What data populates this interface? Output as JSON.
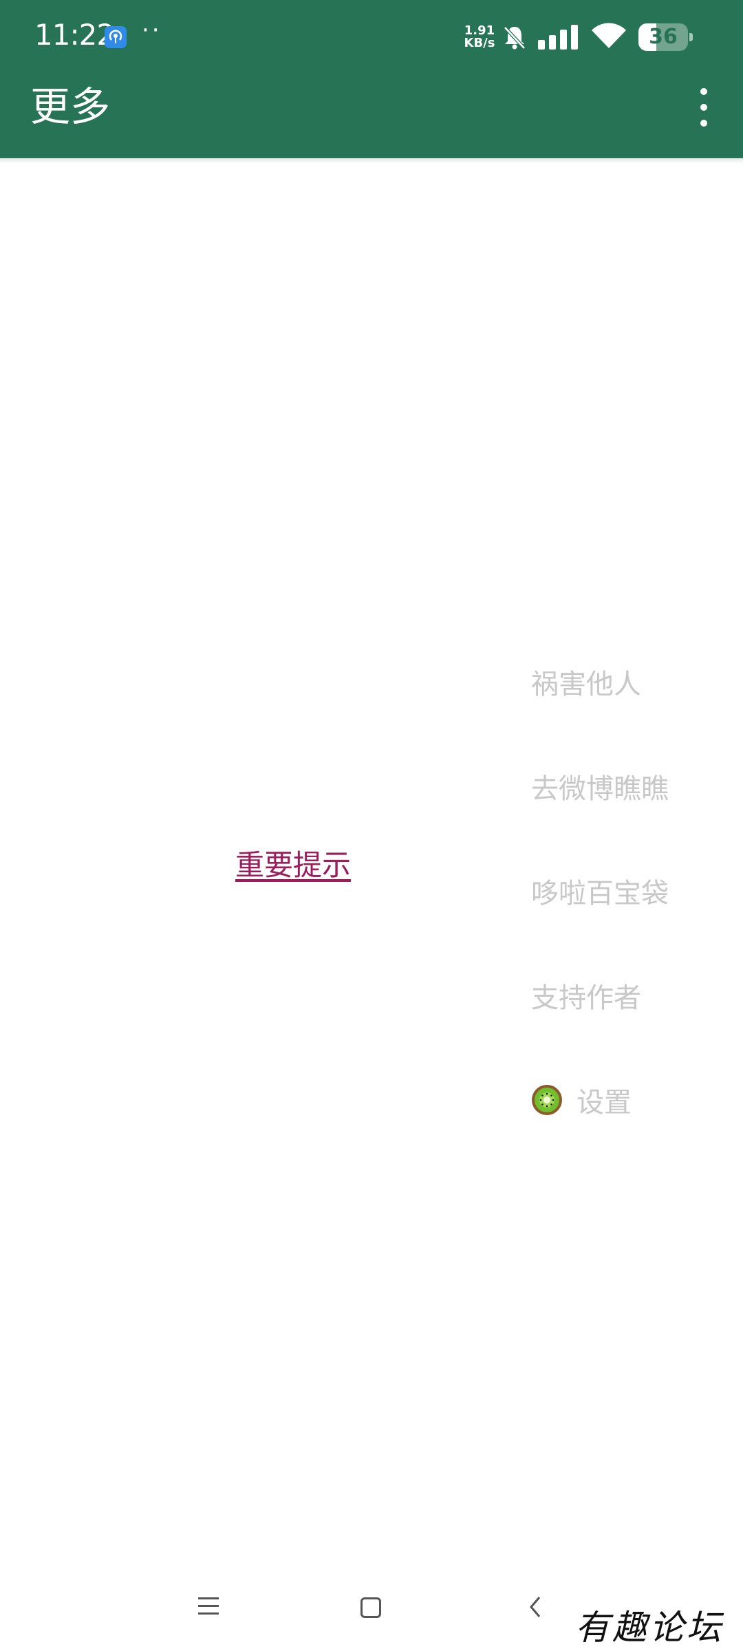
{
  "status_bar": {
    "time": "11:22",
    "dots": "··",
    "net_speed_value": "1.91",
    "net_speed_unit": "KB/s",
    "battery_level": "36",
    "battery_fraction": 0.36,
    "icons": [
      "hotspot-icon",
      "mute-bell-icon",
      "signal-icon",
      "wifi-icon",
      "battery-icon"
    ]
  },
  "app_bar": {
    "title": "更多",
    "overflow_icon": "more-vert-icon"
  },
  "content": {
    "notice_link": "重要提示"
  },
  "menu": {
    "items": [
      {
        "label": "祸害他人"
      },
      {
        "label": "去微博瞧瞧"
      },
      {
        "label": "哆啦百宝袋"
      },
      {
        "label": "支持作者"
      },
      {
        "label": "设置",
        "icon": "kiwi-icon"
      }
    ]
  },
  "nav_bar": {
    "icons": [
      "menu-icon",
      "home-icon",
      "back-icon"
    ]
  },
  "watermark": {
    "text": "有趣论坛"
  },
  "colors": {
    "app_bar": "#277355",
    "link": "#9b1d5c",
    "menu_text": "#c8c8c8",
    "background": "#ffffff"
  }
}
